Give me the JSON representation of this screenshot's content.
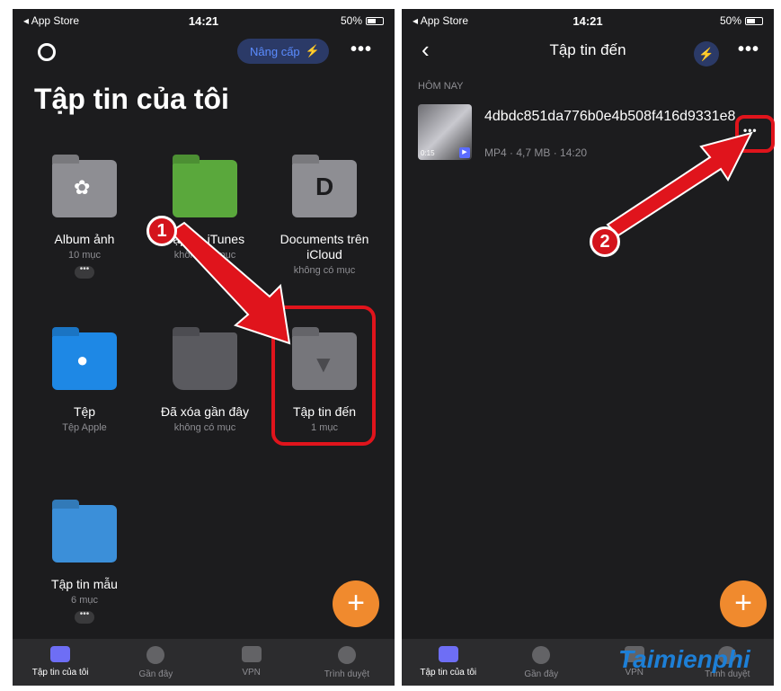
{
  "status": {
    "carrier": "◂ App Store",
    "time": "14:21",
    "battery": "50%"
  },
  "left": {
    "upgrade_label": "Nâng cấp",
    "title": "Tập tin của tôi",
    "folders": [
      {
        "name": "Album ảnh",
        "sub": "10 mục",
        "more": "•••",
        "icon": "photos-folder-icon",
        "color": "#8e8e93"
      },
      {
        "name": "Tập tin iTunes",
        "sub": "không có mục",
        "icon": "itunes-folder-icon",
        "color": "#5aa83c"
      },
      {
        "name": "Documents trên iCloud",
        "sub": "không có mục",
        "icon": "documents-folder-icon",
        "color": "#8e8e93"
      },
      {
        "name": "Tệp",
        "sub": "Tệp Apple",
        "icon": "apple-folder-icon",
        "color": "#1e88e5"
      },
      {
        "name": "Đã xóa gần đây",
        "sub": "không có mục",
        "icon": "trash-icon",
        "color": "#5a5a5f"
      },
      {
        "name": "Tập tin đến",
        "sub": "1 mục",
        "icon": "incoming-folder-icon",
        "color": "#76767b"
      },
      {
        "name": "Tập tin mẫu",
        "sub": "6 mục",
        "more": "•••",
        "icon": "sample-folder-icon",
        "color": "#3b8fd9"
      }
    ],
    "fab": "+"
  },
  "right": {
    "nav_title": "Tập tin đến",
    "section": "HÔM NAY",
    "file": {
      "name": "4dbdc851da776b0e4b508f416d9331e8",
      "meta": "MP4 · 4,7 MB · 14:20",
      "duration": "0:15"
    },
    "more": "•••",
    "fab": "+"
  },
  "tabs": [
    {
      "label": "Tập tin của tôi",
      "icon": "folder-icon",
      "active": true
    },
    {
      "label": "Gần đây",
      "icon": "clock-icon",
      "active": false
    },
    {
      "label": "VPN",
      "icon": "shield-icon",
      "active": false
    },
    {
      "label": "Trình duyệt",
      "icon": "compass-icon",
      "active": false
    }
  ],
  "annotations": {
    "step1": "1",
    "step2": "2"
  },
  "watermark": "Taimienphi",
  "colors": {
    "highlight": "#e0141c",
    "accent": "#f08a2e",
    "upgrade": "#5b8cff"
  }
}
